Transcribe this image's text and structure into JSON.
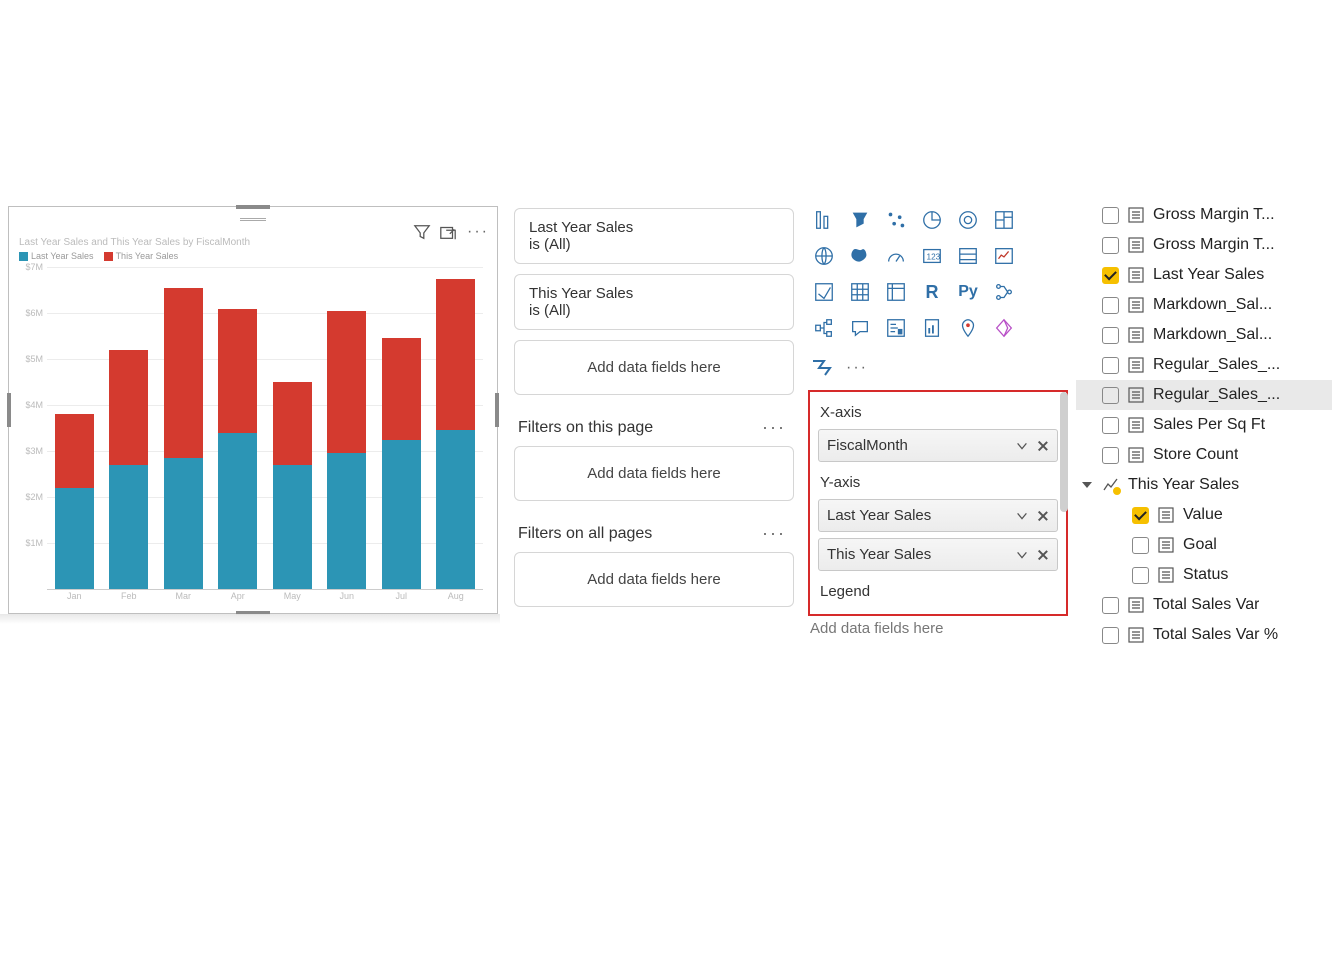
{
  "chart": {
    "title": "Last Year Sales and This Year Sales by FiscalMonth",
    "legend": {
      "series1": "Last Year Sales",
      "series2": "This Year Sales"
    }
  },
  "chart_data": {
    "type": "bar",
    "stacked": true,
    "title": "Last Year Sales and This Year Sales by FiscalMonth",
    "xlabel": "",
    "ylabel": "",
    "ylim": [
      0,
      7000000
    ],
    "y_ticks": [
      "$7M",
      "$6M",
      "$5M",
      "$4M",
      "$3M",
      "$2M",
      "$1M"
    ],
    "categories": [
      "Jan",
      "Feb",
      "Mar",
      "Apr",
      "May",
      "Jun",
      "Jul",
      "Aug"
    ],
    "series": [
      {
        "name": "Last Year Sales",
        "color": "#2c95b5",
        "values": [
          2200000,
          2700000,
          2850000,
          3400000,
          2700000,
          2950000,
          3250000,
          3450000
        ]
      },
      {
        "name": "This Year Sales",
        "color": "#d43a2f",
        "values": [
          1600000,
          2500000,
          3700000,
          2700000,
          1800000,
          3100000,
          2200000,
          3300000
        ]
      }
    ]
  },
  "filters": {
    "card1": {
      "name": "Last Year Sales",
      "state": "is (All)"
    },
    "card2": {
      "name": "This Year Sales",
      "state": "is (All)"
    },
    "add": "Add data fields here",
    "page_head": "Filters on this page",
    "all_head": "Filters on all pages"
  },
  "wells": {
    "xaxis_head": "X-axis",
    "xaxis_field": "FiscalMonth",
    "yaxis_head": "Y-axis",
    "yaxis_field1": "Last Year Sales",
    "yaxis_field2": "This Year Sales",
    "legend_head": "Legend",
    "legend_add": "Add data fields here"
  },
  "fields": {
    "gm1": "Gross Margin T...",
    "gm2": "Gross Margin T...",
    "lys": "Last Year Sales",
    "md1": "Markdown_Sal...",
    "md2": "Markdown_Sal...",
    "reg1": "Regular_Sales_...",
    "reg2": "Regular_Sales_...",
    "sqft": "Sales Per Sq Ft",
    "store": "Store Count",
    "tys": "This Year Sales",
    "value": "Value",
    "goal": "Goal",
    "status": "Status",
    "tsv": "Total Sales Var",
    "tsvp": "Total Sales Var %"
  }
}
